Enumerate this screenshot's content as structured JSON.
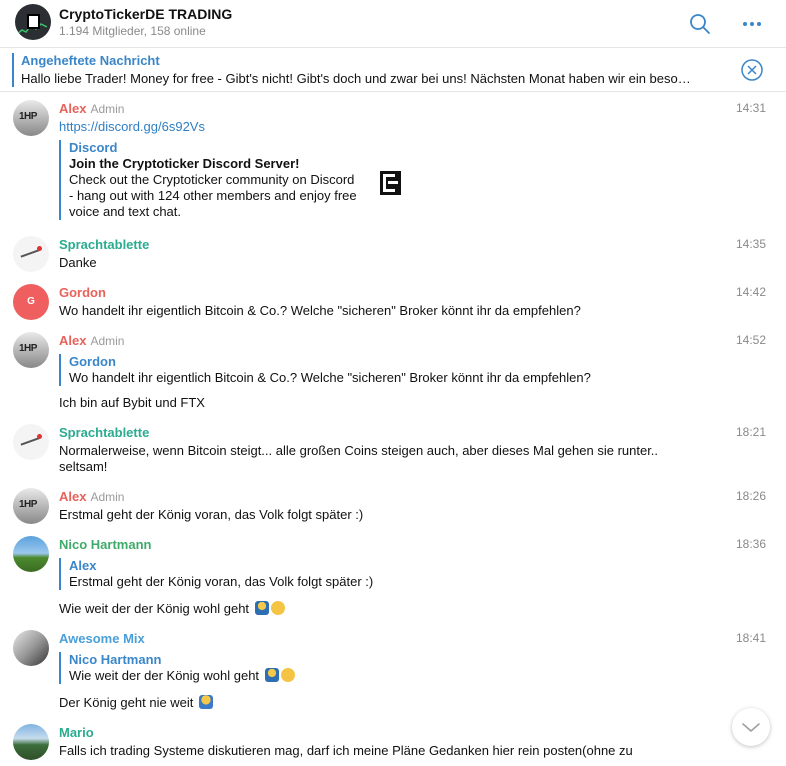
{
  "header": {
    "title": "CryptoTickerDE TRADING",
    "subtitle": "1.194 Mitglieder, 158 online",
    "search_icon": "search-icon",
    "more_icon": "more-icon"
  },
  "pinned": {
    "title": "Angeheftete Nachricht",
    "text": "Hallo liebe Trader!  Money for free - Gibt's nicht! Gibt's doch und zwar bei uns!  Nächsten Monat haben wir ein beso…",
    "close_icon": "close-circle-icon"
  },
  "messages": [
    {
      "author": "Alex",
      "role": "Admin",
      "time": "14:31",
      "link": "https://discord.gg/6s92Vs",
      "preview": {
        "site": "Discord",
        "title": "Join the Cryptoticker Discord Server!",
        "desc": "Check out the Cryptoticker community on Discord - hang out with 124 other members and enjoy free voice and text chat."
      }
    },
    {
      "author": "Sprachtablette",
      "time": "14:35",
      "text": "Danke"
    },
    {
      "author": "Gordon",
      "avatar_letter": "G",
      "time": "14:42",
      "text": "Wo handelt ihr eigentlich Bitcoin & Co.? Welche \"sicheren\" Broker könnt ihr da empfehlen?"
    },
    {
      "author": "Alex",
      "role": "Admin",
      "time": "14:52",
      "reply": {
        "name": "Gordon",
        "text": "Wo handelt ihr eigentlich Bitcoin & Co.? Welche \"sicheren\" Broker könnt ihr da empfehlen?"
      },
      "text": "Ich bin auf Bybit und FTX"
    },
    {
      "author": "Sprachtablette",
      "time": "18:21",
      "text": "Normalerweise, wenn Bitcoin steigt... alle großen Coins steigen auch, aber dieses Mal gehen sie runter..",
      "text2": "seltsam!"
    },
    {
      "author": "Alex",
      "role": "Admin",
      "time": "18:26",
      "text": "Erstmal geht der König voran, das Volk folgt später :)"
    },
    {
      "author": "Nico Hartmann",
      "time": "18:36",
      "reply": {
        "name": "Alex",
        "text": "Erstmal geht der König voran, das Volk folgt später :)"
      },
      "text": "Wie weit der der König wohl geht"
    },
    {
      "author": "Awesome Mix",
      "time": "18:41",
      "reply": {
        "name": "Nico Hartmann",
        "text": "Wie weit der der König wohl geht"
      },
      "text": "Der König geht nie weit"
    },
    {
      "author": "Mario",
      "time": "",
      "text": "Falls ich trading Systeme diskutieren mag, darf ich meine Pläne Gedanken hier rein posten(ohne zu"
    }
  ],
  "colors": {
    "alex": "#e8625a",
    "sprachtablette": "#2bab8f",
    "gordon": "#e8625a",
    "nico": "#3fab6a",
    "awesome": "#4a9fd8",
    "mario": "#2bab8f",
    "accent": "#3a86c8"
  }
}
